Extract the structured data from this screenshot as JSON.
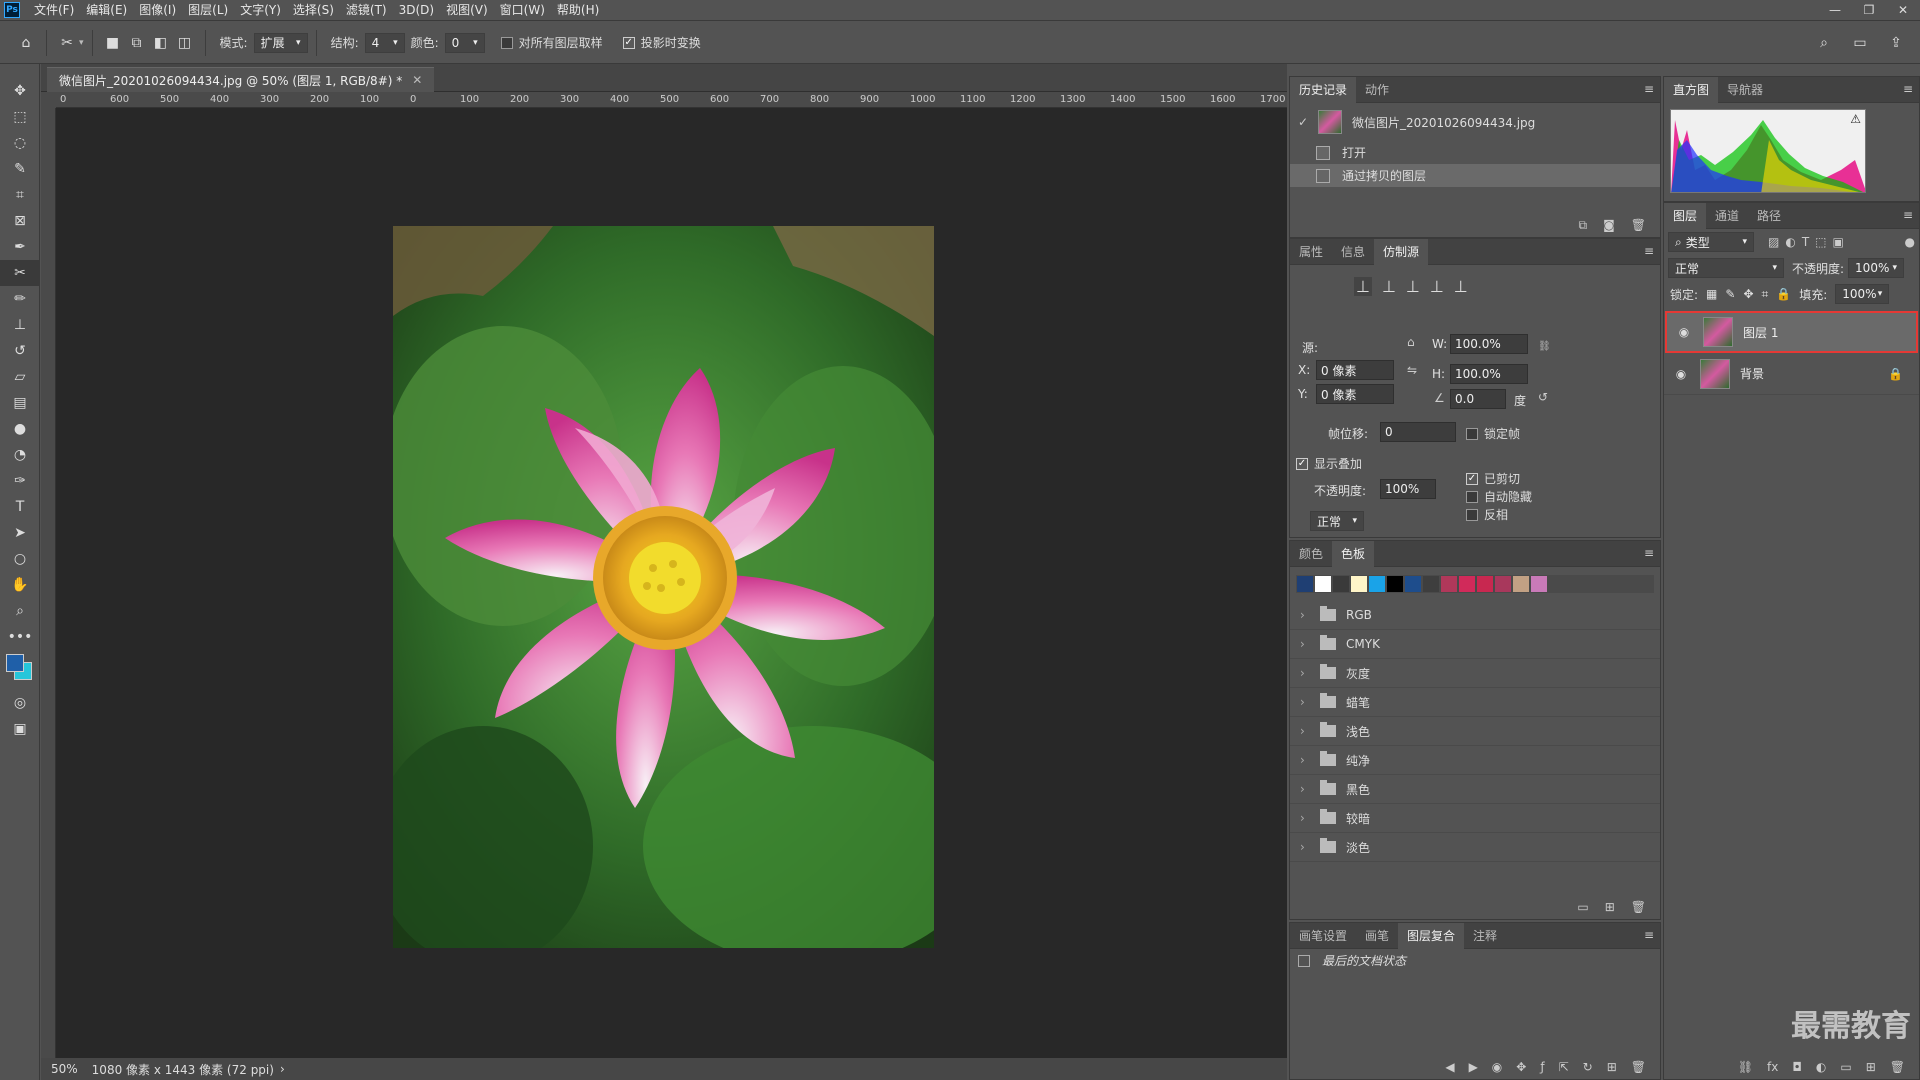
{
  "app": {
    "logo": "Ps"
  },
  "menu": [
    "文件(F)",
    "编辑(E)",
    "图像(I)",
    "图层(L)",
    "文字(Y)",
    "选择(S)",
    "滤镜(T)",
    "3D(D)",
    "视图(V)",
    "窗口(W)",
    "帮助(H)"
  ],
  "options": {
    "mode_label": "模式:",
    "mode_value": "扩展",
    "structure_label": "结构:",
    "structure_value": "4",
    "color_label": "颜色:",
    "color_value": "0",
    "sample_all_label": "对所有图层取样",
    "sample_all_checked": false,
    "transform_label": "投影时变换",
    "transform_checked": true
  },
  "document": {
    "tab_title": "微信图片_20201026094434.jpg @ 50% (图层 1, RGB/8#) *",
    "zoom": "50%",
    "status": "1080 像素 x 1443 像素 (72 ppi)",
    "ruler_ticks": [
      "0",
      "600",
      "500",
      "400",
      "300",
      "200",
      "100",
      "0",
      "100",
      "200",
      "300",
      "400",
      "500",
      "600",
      "700",
      "800",
      "900",
      "1000",
      "1100",
      "1200",
      "1300",
      "1400",
      "1500",
      "1600",
      "1700"
    ]
  },
  "history": {
    "tabs": [
      "历史记录",
      "动作"
    ],
    "snapshot": "微信图片_20201026094434.jpg",
    "items": [
      "打开",
      "通过拷贝的图层"
    ]
  },
  "clone": {
    "tabs": [
      "属性",
      "信息",
      "仿制源"
    ],
    "source_label": "源:",
    "x_label": "X:",
    "x_value": "0 像素",
    "y_label": "Y:",
    "y_value": "0 像素",
    "w_label": "W:",
    "w_value": "100.0%",
    "h_label": "H:",
    "h_value": "100.0%",
    "angle_value": "0.0",
    "angle_unit": "度",
    "frame_offset_label": "帧位移:",
    "frame_offset_value": "0",
    "lock_frame_label": "锁定帧",
    "show_overlay_label": "显示叠加",
    "opacity_label": "不透明度:",
    "opacity_value": "100%",
    "blend_value": "正常",
    "clipped_label": "已剪切",
    "auto_hide_label": "自动隐藏",
    "invert_label": "反相"
  },
  "swatches": {
    "tabs": [
      "颜色",
      "色板"
    ],
    "colors": [
      "#1f3f73",
      "#ffffff",
      "#3a3a3a",
      "#fff5c8",
      "#1aa3e8",
      "#000000",
      "#1e4d8c",
      "#3e3e3e",
      "#b0385a",
      "#d12a5a",
      "#c82850",
      "#a8385c",
      "#c2a184",
      "#c97ab8"
    ],
    "folders": [
      "RGB",
      "CMYK",
      "灰度",
      "蜡笔",
      "浅色",
      "纯净",
      "黑色",
      "较暗",
      "淡色"
    ]
  },
  "bottom_panel": {
    "tabs": [
      "画笔设置",
      "画笔",
      "图层复合",
      "注释"
    ],
    "item": "最后的文档状态"
  },
  "histogram": {
    "tabs": [
      "直方图",
      "导航器"
    ]
  },
  "layers": {
    "tabs": [
      "图层",
      "通道",
      "路径"
    ],
    "filter_label": "类型",
    "blend_mode": "正常",
    "opacity_label": "不透明度:",
    "opacity_value": "100%",
    "lock_label": "锁定:",
    "fill_label": "填充:",
    "fill_value": "100%",
    "items": [
      {
        "name": "图层 1",
        "selected": true
      },
      {
        "name": "背景",
        "selected": false
      }
    ]
  },
  "watermark": "最需教育",
  "colors": {
    "highlight_border": "#e53935",
    "foreground": "#1f5fa8",
    "background": "#26c6da"
  }
}
